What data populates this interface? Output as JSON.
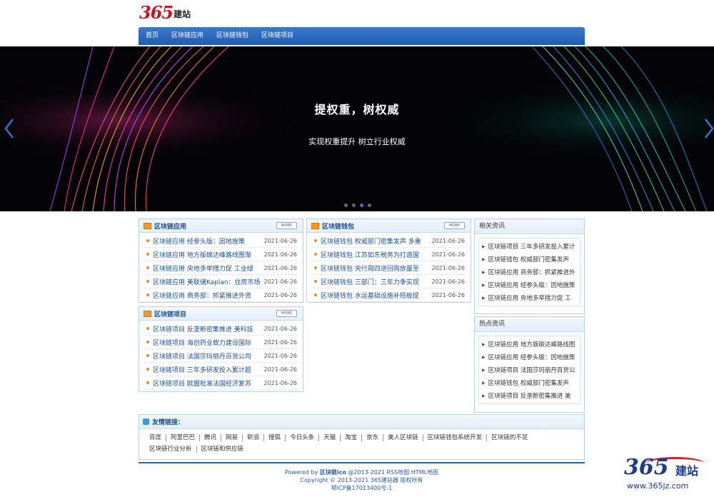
{
  "logo": {
    "number": "365",
    "text": "建站"
  },
  "nav": [
    "首页",
    "区块链应用",
    "区块链钱包",
    "区块链项目"
  ],
  "banner": {
    "title": "提权重，树权威",
    "subtitle": "实现权重提升 树立行业权威",
    "slide_count": 4,
    "active_slide": 2
  },
  "boxes": {
    "app": {
      "title": "区块链应用",
      "more": "MORE",
      "items": [
        {
          "t": "区块链应用 经参头版：因地施策",
          "d": "2021-06-26"
        },
        {
          "t": "区块链应用 地方版碳达峰路线图渐",
          "d": "2021-06-26"
        },
        {
          "t": "区块链应用 央地多举措力促 工业绿",
          "d": "2021-06-26"
        },
        {
          "t": "区块链应用 美联储Kaplan：住房市场",
          "d": "2021-06-26"
        },
        {
          "t": "区块链应用 商务部：抓紧推进外资",
          "d": "2021-06-26"
        }
      ]
    },
    "wallet": {
      "title": "区块链钱包",
      "more": "MORE",
      "items": [
        {
          "t": "区块链钱包 权威部门密集发声 多重",
          "d": "2021-06-26"
        },
        {
          "t": "区块链钱包 江苏如东税务为打造国",
          "d": "2021-06-26"
        },
        {
          "t": "区块链钱包 央行周四逆回购放量至",
          "d": "2021-06-26"
        },
        {
          "t": "区块链钱包 三部门：三年力争实现",
          "d": "2021-06-26"
        },
        {
          "t": "区块链钱包 水运基础设施补短板提",
          "d": "2021-06-26"
        }
      ]
    },
    "project": {
      "title": "区块链项目",
      "more": "MORE",
      "items": [
        {
          "t": "区块链项目 反垄断密集推进 美科技",
          "d": "2021-06-26"
        },
        {
          "t": "区块链项目 海创药业致力建设国际",
          "d": "2021-06-26"
        },
        {
          "t": "区块链项目 法国莎玛丽丹百货公司",
          "d": "2021-06-26"
        },
        {
          "t": "区块链项目 三年多研发投入累计超",
          "d": "2021-06-26"
        },
        {
          "t": "区块链项目 欧盟批准法国经济复苏",
          "d": "2021-06-26"
        }
      ]
    }
  },
  "related": {
    "title": "相关资讯",
    "items": [
      "区块链项目 三年多研发投入累计",
      "区块链钱包 权威部门密集发声",
      "区块链应用 商务部：抓紧推进外",
      "区块链应用 经参头版：因地施策",
      "区块链应用 央地多举措力促 工"
    ]
  },
  "hot": {
    "title": "热点资讯",
    "items": [
      "区块链应用 地方版碳达峰路线图",
      "区块链应用 经参头版：因地施策",
      "区块链项目 法国莎玛丽丹百货公",
      "区块链钱包 权威部门密集发声",
      "区块链项目 反垄断密集推进 美"
    ]
  },
  "links": {
    "title": "友情链接：",
    "items": [
      "百度",
      "阿里巴巴",
      "腾讯",
      "网易",
      "新浪",
      "搜狐",
      "今日头条",
      "天猫",
      "淘宝",
      "京东",
      "美人区块链",
      "区块链钱包系统开发",
      "区块链的不足",
      "区块链行业分析",
      "区块链和供应链"
    ]
  },
  "footer": {
    "line1_prefix": "Powered by ",
    "line1_brand": "区块链ico",
    "line1_rest": " @2013-2021 RSS地图 HTML地图",
    "line2": "Copyright © 2013-2021 365建站器 版权所有",
    "line3": "鄂ICP备17013400号-1"
  },
  "watermark": {
    "number": "365",
    "text": "建站",
    "url": "www.365jz.com"
  },
  "colors": {
    "nav": "#2a68bf",
    "brand_red": "#c8161d",
    "accent_blue": "#1b3c8c"
  }
}
